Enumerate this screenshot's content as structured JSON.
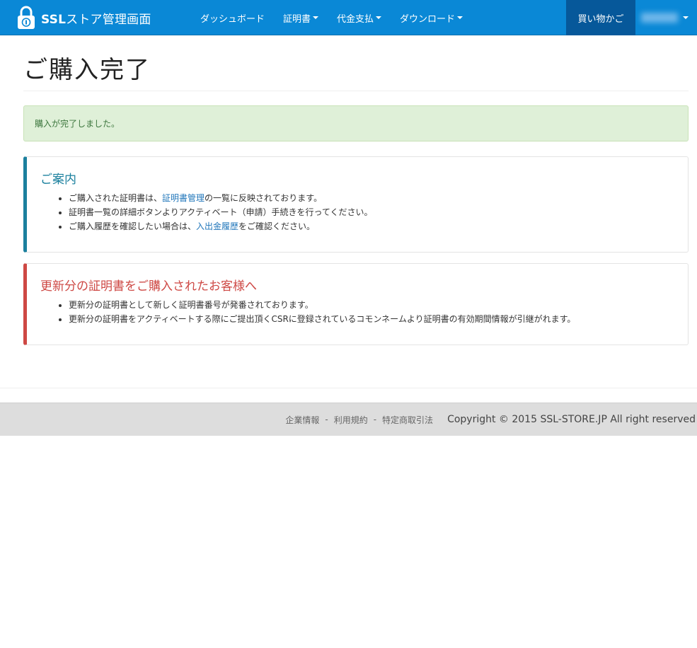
{
  "navbar": {
    "brand_bold": "SSL",
    "brand_rest": "ストア管理画面",
    "items": [
      {
        "label": "ダッシュボード",
        "dropdown": false
      },
      {
        "label": "証明書",
        "dropdown": true
      },
      {
        "label": "代金支払",
        "dropdown": true
      },
      {
        "label": "ダウンロード",
        "dropdown": true
      }
    ],
    "cart_label": "買い物かご"
  },
  "page": {
    "title": "ご購入完了"
  },
  "alert": {
    "message": "購入が完了しました。"
  },
  "info_callout": {
    "title": "ご案内",
    "item1_prefix": "ご購入された証明書は、",
    "item1_link": "証明書管理",
    "item1_suffix": "の一覧に反映されております。",
    "item2": "証明書一覧の詳細ボタンよりアクティベート（申請）手続きを行ってください。",
    "item3_prefix": "ご購入履歴を確認したい場合は、",
    "item3_link": "入出金履歴",
    "item3_suffix": "をご確認ください。"
  },
  "renewal_callout": {
    "title": "更新分の証明書をご購入されたお客様へ",
    "items": [
      "更新分の証明書として新しく証明書番号が発番されております。",
      "更新分の証明書をアクティベートする際にご提出頂くCSRに登録されているコモンネームより証明書の有効期間情報が引継がれます。"
    ]
  },
  "footer": {
    "links": [
      "企業情報",
      "利用規約",
      "特定商取引法"
    ],
    "separator": "-",
    "copyright": "Copyright © 2015 SSL-STORE.JP All right reserved"
  },
  "colors": {
    "navbar": "#0a88d6",
    "cart_active": "#06589a",
    "info_accent": "#1b809e",
    "danger_accent": "#ce4844",
    "alert_bg": "#dff0d8"
  },
  "icons": {
    "brand": "padlock-icon",
    "dropdown": "caret-down-icon"
  }
}
